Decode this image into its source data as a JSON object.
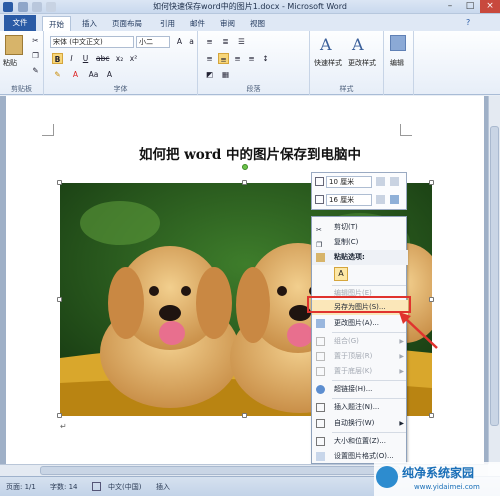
{
  "window": {
    "title": "如何快速保存word中的图片1.docx - Microsoft Word"
  },
  "tabs": {
    "file": "文件",
    "items": [
      "开始",
      "插入",
      "页面布局",
      "引用",
      "邮件",
      "审阅",
      "视图"
    ]
  },
  "ribbon": {
    "groups": {
      "clipboard": "剪贴板",
      "font": "字体",
      "paragraph": "段落",
      "styles": "样式",
      "editing": "编辑"
    },
    "paste": "粘贴",
    "font_name": "宋体 (中文正文)",
    "font_size": "小二",
    "quick_styles": "快速样式",
    "change_styles": "更改样式",
    "editing_btn": "编辑",
    "icons": [
      "cut-icon",
      "copy-icon",
      "format-painter-icon",
      "bold-icon",
      "italic-icon",
      "underline-icon",
      "strikethrough-icon",
      "subscript-icon",
      "superscript-icon",
      "highlight-icon",
      "font-color-icon",
      "bullets-icon",
      "numbering-icon",
      "align-left-icon",
      "center-icon",
      "align-right-icon",
      "justify-icon"
    ]
  },
  "document": {
    "heading": "如何把 word 中的图片保存到电脑中",
    "para_mark": "↵"
  },
  "minitoolbar": {
    "height": "10 厘米",
    "width": "16 厘米"
  },
  "context_menu": {
    "items": [
      {
        "label": "剪切(T)",
        "enabled": true,
        "icon": "scissors-icon"
      },
      {
        "label": "复制(C)",
        "enabled": true,
        "icon": "copy-icon"
      },
      {
        "label": "粘贴选项:",
        "enabled": true,
        "icon": "paste-icon",
        "header": true
      },
      {
        "label": "A",
        "enabled": true,
        "icon": "paste-text-icon",
        "paste_option": true
      },
      {
        "label": "编辑图片(E)",
        "enabled": false,
        "icon": ""
      },
      {
        "label": "另存为图片(S)...",
        "enabled": true,
        "icon": "",
        "highlighted": true
      },
      {
        "label": "更改图片(A)...",
        "enabled": true,
        "icon": "change-picture-icon"
      },
      {
        "label": "组合(G)",
        "enabled": false,
        "icon": "group-icon",
        "submenu": true
      },
      {
        "label": "置于顶层(R)",
        "enabled": false,
        "icon": "bring-front-icon",
        "submenu": true
      },
      {
        "label": "置于底层(K)",
        "enabled": false,
        "icon": "send-back-icon",
        "submenu": true
      },
      {
        "label": "超链接(H)...",
        "enabled": true,
        "icon": "hyperlink-icon"
      },
      {
        "label": "插入题注(N)...",
        "enabled": true,
        "icon": "caption-icon"
      },
      {
        "label": "自动换行(W)",
        "enabled": true,
        "icon": "wrap-icon",
        "submenu": true
      },
      {
        "label": "大小和位置(Z)...",
        "enabled": true,
        "icon": "size-icon"
      },
      {
        "label": "设置图片格式(O)...",
        "enabled": true,
        "icon": "format-picture-icon"
      }
    ]
  },
  "statusbar": {
    "page": "页面: 1/1",
    "words": "字数: 14",
    "lang": "中文(中国)",
    "mode": "插入"
  },
  "watermark": {
    "brand": "纯净系统家园",
    "url": "www.yidaimei.com"
  },
  "colors": {
    "file_tab": "#2a5ba6",
    "highlight_red": "#e0332e",
    "ribbon_bg": "#e7eef8"
  }
}
